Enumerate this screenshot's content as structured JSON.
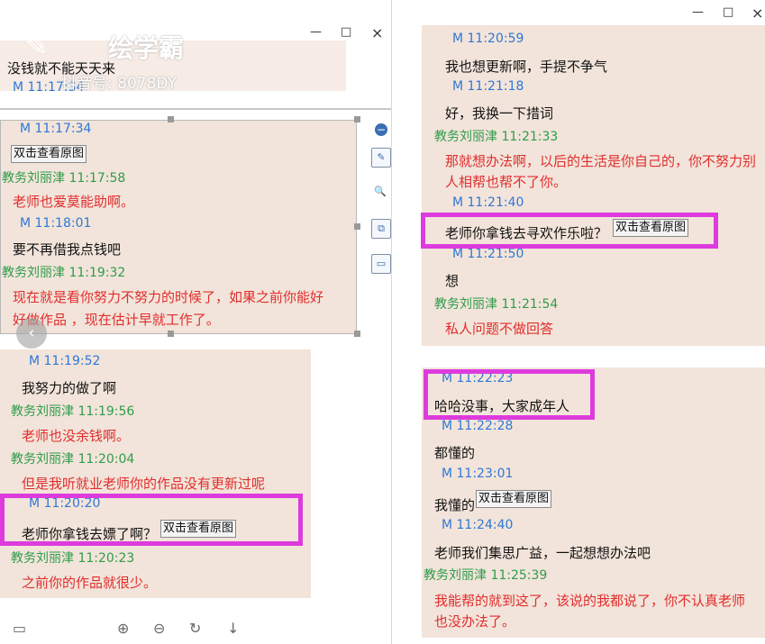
{
  "window": {
    "minimize": "—",
    "maximize": "□",
    "close": "×"
  },
  "watermark": {
    "brand": "绘学霸",
    "sub": "抖音号: 8078DY"
  },
  "left": {
    "top_snippet": {
      "text": "没钱就不能天天来",
      "time": "M 11:17:34"
    },
    "panel1": [
      {
        "type": "m",
        "text": "M 11:17:34"
      },
      {
        "type": "btn",
        "text": "双击查看原图"
      },
      {
        "type": "t",
        "text": "教务刘丽津 11:17:58"
      },
      {
        "type": "red",
        "text": "老师也爱莫能助啊。"
      },
      {
        "type": "m",
        "text": "M 11:18:01"
      },
      {
        "type": "msg",
        "text": "要不再借我点钱吧"
      },
      {
        "type": "t",
        "text": "教务刘丽津 11:19:32"
      },
      {
        "type": "red",
        "text": "现在就是看你努力不努力的时候了，如果之前你能好"
      },
      {
        "type": "red",
        "text": "好做作品 ，现在估计早就工作了。"
      }
    ],
    "panel2": [
      {
        "type": "m",
        "text": "M 11:19:52"
      },
      {
        "type": "msg",
        "text": "我努力的做了啊"
      },
      {
        "type": "t",
        "text": "教务刘丽津 11:19:56"
      },
      {
        "type": "red",
        "text": "老师也没余钱啊。"
      },
      {
        "type": "t",
        "text": "教务刘丽津 11:20:04"
      },
      {
        "type": "red",
        "text": "但是我听就业老师你的作品没有更新过呢"
      },
      {
        "type": "m",
        "text": "M 11:20:20"
      },
      {
        "type": "msg",
        "text": "老师你拿钱去嫖了啊？",
        "btn": "双击查看原图"
      },
      {
        "type": "t",
        "text": "教务刘丽津 11:20:23"
      },
      {
        "type": "red",
        "text": "之前你的作品就很少。"
      }
    ]
  },
  "right": {
    "panel1": [
      {
        "type": "m",
        "text": "M 11:20:59"
      },
      {
        "type": "msg",
        "text": "我也想更新啊，手提不争气"
      },
      {
        "type": "m",
        "text": "M 11:21:18"
      },
      {
        "type": "msg",
        "text": "好，我换一下措词"
      },
      {
        "type": "t",
        "text": "教务刘丽津 11:21:33"
      },
      {
        "type": "red",
        "text": "那就想办法啊，以后的生活是你自己的，你不努力别"
      },
      {
        "type": "red",
        "text": "人相帮也帮不了你。"
      },
      {
        "type": "m",
        "text": "M 11:21:40"
      },
      {
        "type": "msg",
        "text": "老师你拿钱去寻欢作乐啦？",
        "btn": "双击查看原图"
      },
      {
        "type": "m",
        "text": "M 11:21:50"
      },
      {
        "type": "msg",
        "text": "想"
      },
      {
        "type": "t",
        "text": "教务刘丽津 11:21:54"
      },
      {
        "type": "red",
        "text": "私人问题不做回答"
      }
    ],
    "panel2": [
      {
        "type": "m",
        "text": "M 11:22:23"
      },
      {
        "type": "msg",
        "text": "哈哈没事，大家成年人"
      },
      {
        "type": "m",
        "text": "M 11:22:28"
      },
      {
        "type": "msg",
        "text": "都懂的"
      },
      {
        "type": "m",
        "text": "M 11:23:01"
      },
      {
        "type": "msg",
        "text": "我懂的",
        "btn": "双击查看原图"
      },
      {
        "type": "m",
        "text": "M 11:24:40"
      },
      {
        "type": "msg",
        "text": "老师我们集思广益，一起想想办法吧"
      },
      {
        "type": "t",
        "text": "教务刘丽津 11:25:39"
      },
      {
        "type": "red",
        "text": "我能帮的就到这了，该说的我都说了，你不认真老师"
      },
      {
        "type": "red",
        "text": "也没办法了。"
      }
    ]
  },
  "toolbar": {
    "zoom_in": "⊕",
    "zoom_out": "⊖",
    "rotate": "↻",
    "download": "↓",
    "screen": "▭"
  },
  "side_tools": [
    "−",
    "✎",
    "🔍",
    "⧉",
    "▭"
  ]
}
